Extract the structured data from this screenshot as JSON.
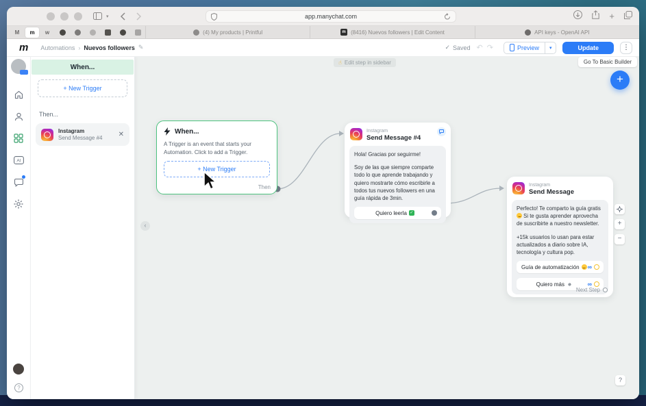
{
  "browser": {
    "url": "app.manychat.com",
    "tabs": [
      {
        "label": "(4) My products | Printful"
      },
      {
        "label": "(8416) Nuevos followers | Edit Content"
      },
      {
        "label": "API keys - OpenAI API"
      }
    ]
  },
  "header": {
    "breadcrumb_section": "Automations",
    "breadcrumb_sep": "›",
    "breadcrumb_page": "Nuevos followers",
    "saved_label": "Saved",
    "preview_label": "Preview",
    "update_label": "Update",
    "more_label": "⋮"
  },
  "canvas_top": {
    "edit_tooltip": "Edit step in sidebar",
    "go_basic_builder": "Go To Basic Builder"
  },
  "side_panel": {
    "when_title": "When...",
    "new_trigger_label": "+ New Trigger",
    "then_label": "Then...",
    "step": {
      "channel": "Instagram",
      "title": "Send Message #4"
    }
  },
  "when_node": {
    "title": "When...",
    "description": "A Trigger is an event that starts your Automation. Click to add a Trigger.",
    "new_trigger_label": "+ New Trigger",
    "then_label": "Then"
  },
  "msg4_node": {
    "channel": "Instagram",
    "title": "Send Message #4",
    "p1": "Hola! Gracias por seguirme!",
    "p2": "Soy de las que siempre comparte todo lo que aprende trabajando y quiero mostrarte cómo escribirle a todos tus nuevos followers en una guía rápida de 3min.",
    "button_label": "Quiero leerla"
  },
  "msg_node": {
    "channel": "Instagram",
    "title": "Send Message",
    "p1a": "Perfecto! Te comparto la guía gratis",
    "p1b": "Si te gusta aprender aprovecha de suscribirte a nuestro newsletter.",
    "p2": "+15k usuarios lo usan para estar actualizados a diario sobre IA, tecnología y cultura pop.",
    "button1_label": "Guía de automatización",
    "button2_label": "Quiero más",
    "next_step_label": "Next Step"
  },
  "colors": {
    "accent_blue": "#2b7cf7",
    "node_green_border": "#4cc27e",
    "when_header_green": "#d9f2e4",
    "canvas_bg": "#edf0ef",
    "connector_yellow": "#f2c230"
  }
}
